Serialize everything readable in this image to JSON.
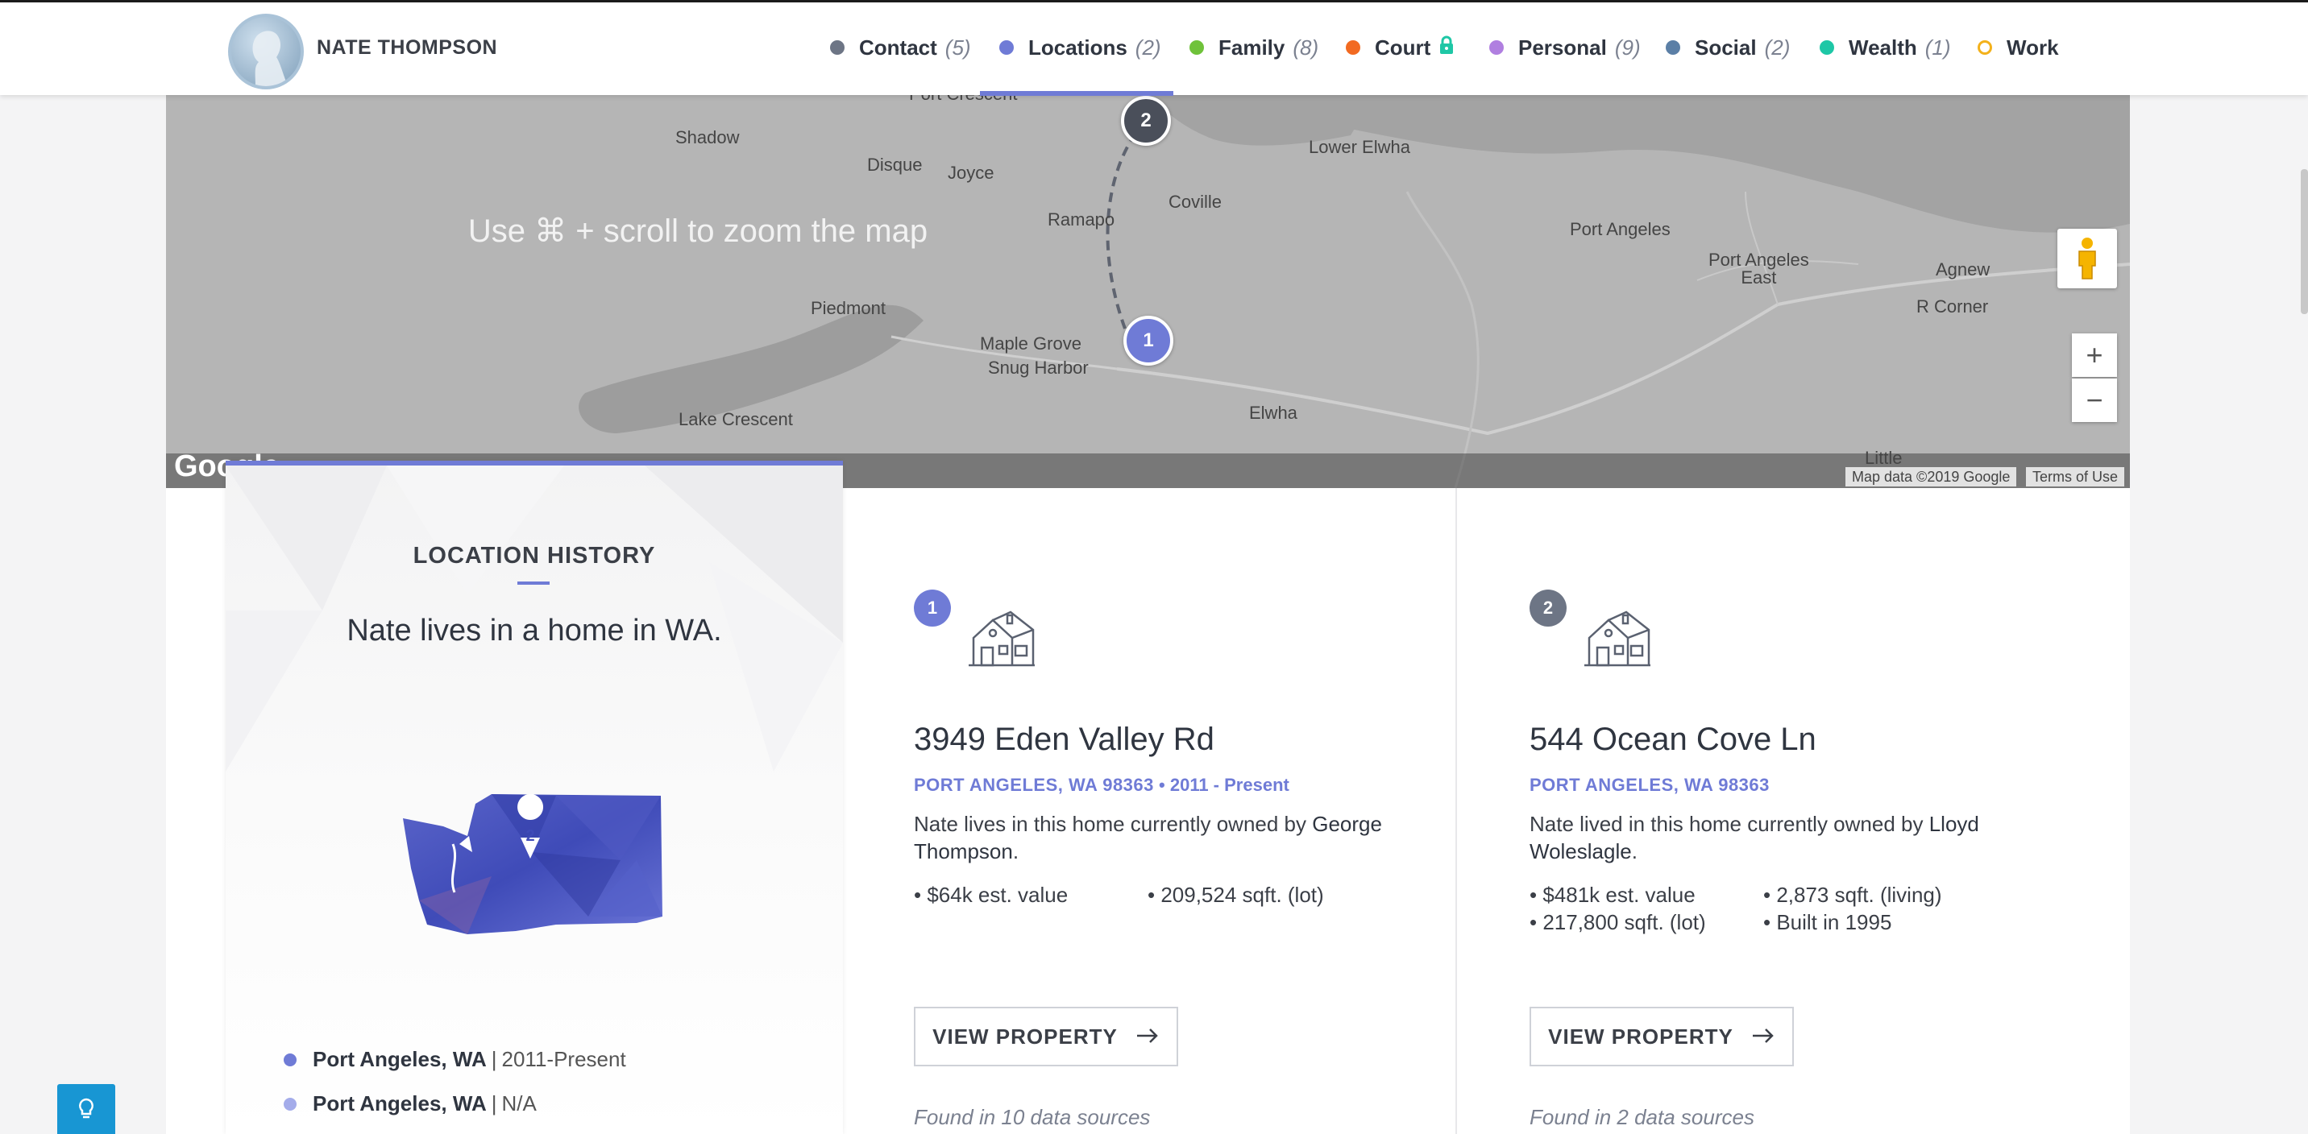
{
  "header": {
    "name": "NATE THOMPSON",
    "avatar_icon": "person-silhouette-icon",
    "nav": [
      {
        "label": "Contact",
        "count": "(5)",
        "color": "#6d7585"
      },
      {
        "label": "Locations",
        "count": "(2)",
        "color": "#6f7bd6",
        "active": true
      },
      {
        "label": "Family",
        "count": "(8)",
        "color": "#6fc23a"
      },
      {
        "label": "Court",
        "count": "",
        "color": "#f26a21",
        "icon": "lock-icon"
      },
      {
        "label": "Personal",
        "count": "(9)",
        "color": "#b07fe0"
      },
      {
        "label": "Social",
        "count": "(2)",
        "color": "#5b7fa6"
      },
      {
        "label": "Wealth",
        "count": "(1)",
        "color": "#1ec7a6"
      },
      {
        "label": "Work",
        "count": "",
        "color": "#f3b11b",
        "hollow": true
      }
    ]
  },
  "map": {
    "hint": "Use ⌘ + scroll to zoom the map",
    "labels": {
      "port_crescent": "Port Crescent",
      "shadow": "Shadow",
      "disque": "Disque",
      "joyce": "Joyce",
      "ramapo": "Ramapo",
      "coville": "Coville",
      "lower_elwha": "Lower Elwha",
      "port_angeles": "Port Angeles",
      "port_angeles_east": "Port Angeles\nEast",
      "agnew": "Agnew",
      "r_corner": "R Corner",
      "piedmont": "Piedmont",
      "maple_grove": "Maple Grove",
      "snug_harbor": "Snug Harbor",
      "lake_crescent": "Lake Crescent",
      "elwha": "Elwha",
      "little": "Little"
    },
    "pins": [
      "1",
      "2"
    ],
    "zoom_in": "+",
    "zoom_out": "−",
    "attribution": "Map data ©2019 Google",
    "terms": "Terms of Use",
    "logo": "Google"
  },
  "history": {
    "title": "LOCATION HISTORY",
    "summary": "Nate lives in a home in WA.",
    "state_marker": "2",
    "items": [
      {
        "place": "Port Angeles, WA",
        "sep": "|",
        "period": "2011-Present",
        "color": "#6f7bd6"
      },
      {
        "place": "Port Angeles, WA",
        "sep": "|",
        "period": "N/A",
        "color": "#a4acea"
      }
    ]
  },
  "properties": [
    {
      "number": "1",
      "number_color": "#6f7bd6",
      "address": "3949 Eden Valley Rd",
      "city": "PORT ANGELES, WA 98363",
      "years": "• 2011 - Present",
      "desc_prefix": "Nate lives in this home currently owned by",
      "owner": "George Thompson",
      "facts": [
        "• $64k est. value",
        "• 209,524 sqft. (lot)"
      ],
      "button": "VIEW PROPERTY",
      "sources": "Found in 10 data sources"
    },
    {
      "number": "2",
      "number_color": "#6d7585",
      "address": "544 Ocean Cove Ln",
      "city": "PORT ANGELES, WA 98363",
      "years": "",
      "desc_prefix": "Nate lived in this home currently owned by",
      "owner": "Lloyd Woleslagle",
      "facts": [
        "• $481k est. value",
        "• 2,873 sqft. (living)",
        "• 217,800 sqft. (lot)",
        "• Built in 1995"
      ],
      "button": "VIEW PROPERTY",
      "sources": "Found in 2 data sources"
    }
  ]
}
